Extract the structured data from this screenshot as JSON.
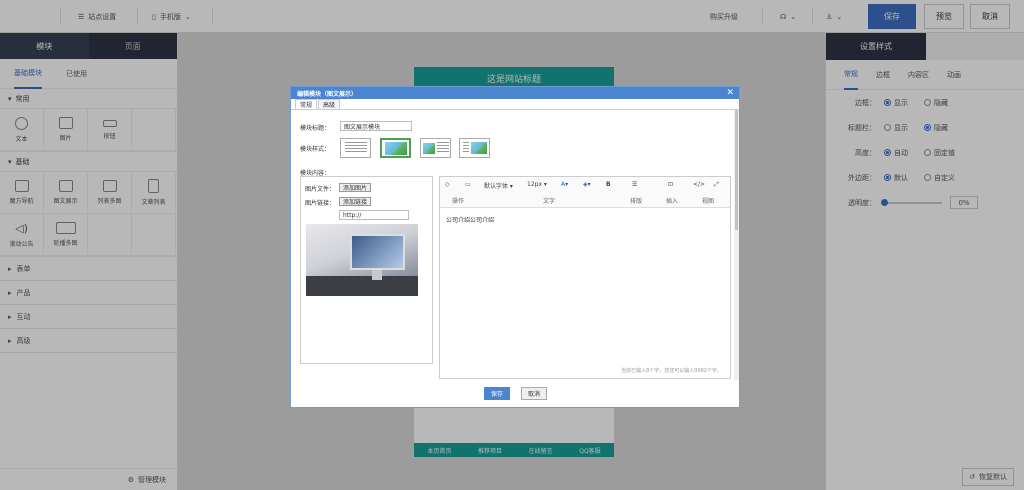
{
  "topbar": {
    "site_settings": "站点设置",
    "device": "手机版",
    "buy_upgrade": "购买升级",
    "save": "保存",
    "preview": "预览",
    "cancel": "取消",
    "accent": "#3f6ec2"
  },
  "left": {
    "tab_modules": "模块",
    "tab_pages": "页面",
    "sub_basic": "基础模块",
    "sub_used": "已使用",
    "cat_common": "常用",
    "common_items": [
      "文本",
      "图片",
      "按钮"
    ],
    "cat_basic": "基础",
    "basic_items": [
      "魔方导航",
      "图文展示",
      "列表多图",
      "文章列表",
      "滚动公告",
      "轮播多图"
    ],
    "collapsed": [
      "表单",
      "产品",
      "互动",
      "高级"
    ],
    "manage": "管理模块"
  },
  "canvas": {
    "site_title": "这是网站标题",
    "footer_items": [
      "本页首页",
      "推荐项目",
      "在线留言",
      "QQ客服"
    ]
  },
  "right": {
    "header": "设置样式",
    "tabs": [
      "常规",
      "边框",
      "内容区",
      "动画"
    ],
    "rows": [
      {
        "label": "边框：",
        "opts": [
          "显示",
          "隐藏"
        ],
        "sel": 0
      },
      {
        "label": "标题栏：",
        "opts": [
          "显示",
          "隐藏"
        ],
        "sel": 1
      },
      {
        "label": "高度：",
        "opts": [
          "自动",
          "固定值"
        ],
        "sel": 0
      },
      {
        "label": "外边距：",
        "opts": [
          "默认",
          "自定义"
        ],
        "sel": 0
      }
    ],
    "opacity_label": "透明度：",
    "opacity_value": "0%",
    "opacity_fraction": 0,
    "reset": "恢复默认"
  },
  "modal": {
    "title": "编辑模块（图文展示）",
    "tabs": [
      "常规",
      "高级"
    ],
    "module_title_label": "模块标题：",
    "module_title_value": "图文展示模块",
    "style_label": "模块样式：",
    "content_label": "模块内容：",
    "img_file_label": "图片文件：",
    "add_image": "添加图片",
    "img_link_label": "图片链接：",
    "add_link": "添加链接",
    "link_value": "http://",
    "toolbar": {
      "font": "默认字体",
      "size": "12px",
      "bold": "B",
      "groups": [
        "操作",
        "文字",
        "排版",
        "插入",
        "视图"
      ]
    },
    "body_text": "公司介绍公司介绍",
    "counter": "当前已输入8个字，您还可以输入9992个字。",
    "save": "保存",
    "cancel": "取消"
  }
}
